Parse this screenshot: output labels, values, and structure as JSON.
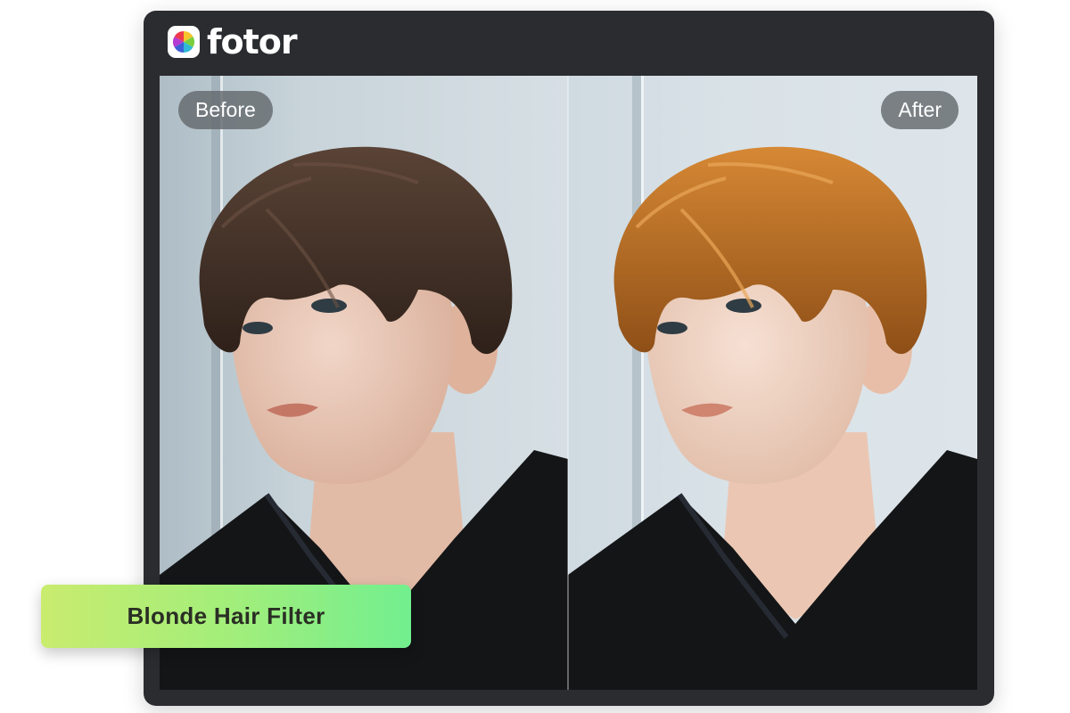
{
  "brand": {
    "name": "fotor",
    "icon": "fotor-logo-icon"
  },
  "comparison": {
    "before_label": "Before",
    "after_label": "After"
  },
  "filter": {
    "label": "Blonde Hair Filter"
  },
  "colors": {
    "window_bg": "#2b2c30",
    "badge_gradient_start": "#c9ec6e",
    "badge_gradient_end": "#72ef8f",
    "hair_before": "#3e2c22",
    "hair_after": "#c07324"
  }
}
